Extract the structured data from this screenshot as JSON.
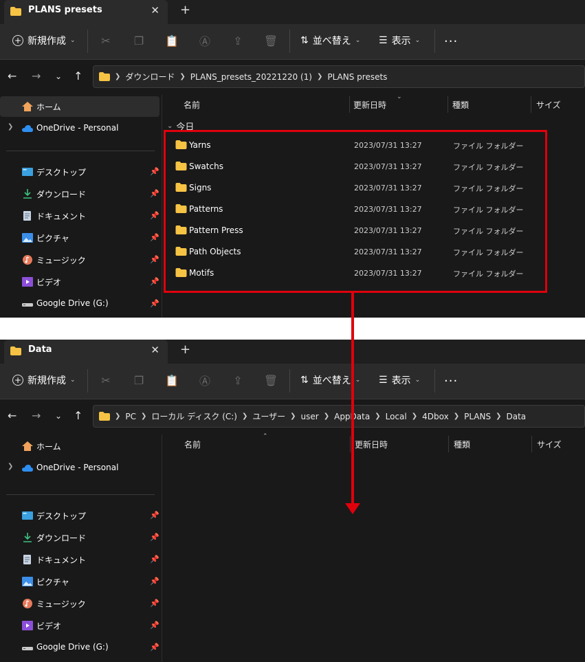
{
  "colors": {
    "window_bg": "#191919",
    "toolbar_bg": "#2b2b2b",
    "folder_yellow": "#f6c344",
    "annotation_red": "#e0000c"
  },
  "top": {
    "tab_title": "PLANS presets",
    "toolbar": {
      "new_label": "新規作成",
      "sort_label": "並べ替え",
      "view_label": "表示",
      "more_label": "..."
    },
    "breadcrumb": [
      "ダウンロード",
      "PLANS_presets_20221220 (1)",
      "PLANS presets"
    ],
    "columns": {
      "name": "名前",
      "date": "更新日時",
      "type": "種類",
      "size": "サイズ"
    },
    "group_label": "今日",
    "files": [
      {
        "name": "Yarns",
        "date": "2023/07/31 13:27",
        "type": "ファイル フォルダー"
      },
      {
        "name": "Swatchs",
        "date": "2023/07/31 13:27",
        "type": "ファイル フォルダー"
      },
      {
        "name": "Signs",
        "date": "2023/07/31 13:27",
        "type": "ファイル フォルダー"
      },
      {
        "name": "Patterns",
        "date": "2023/07/31 13:27",
        "type": "ファイル フォルダー"
      },
      {
        "name": "Pattern Press",
        "date": "2023/07/31 13:27",
        "type": "ファイル フォルダー"
      },
      {
        "name": "Path Objects",
        "date": "2023/07/31 13:27",
        "type": "ファイル フォルダー"
      },
      {
        "name": "Motifs",
        "date": "2023/07/31 13:27",
        "type": "ファイル フォルダー"
      }
    ]
  },
  "bottom": {
    "tab_title": "Data",
    "toolbar": {
      "new_label": "新規作成",
      "sort_label": "並べ替え",
      "view_label": "表示",
      "more_label": "..."
    },
    "breadcrumb": [
      "PC",
      "ローカル ディスク (C:)",
      "ユーザー",
      "user",
      "AppData",
      "Local",
      "4Dbox",
      "PLANS",
      "Data"
    ],
    "columns": {
      "name": "名前",
      "date": "更新日時",
      "type": "種類",
      "size": "サイズ"
    }
  },
  "sidebar": {
    "home": "ホーム",
    "onedrive": "OneDrive - Personal",
    "items": [
      {
        "label": "デスクトップ",
        "icon": "desktop-icon"
      },
      {
        "label": "ダウンロード",
        "icon": "download-icon"
      },
      {
        "label": "ドキュメント",
        "icon": "document-icon"
      },
      {
        "label": "ピクチャ",
        "icon": "pictures-icon"
      },
      {
        "label": "ミュージック",
        "icon": "music-icon"
      },
      {
        "label": "ビデオ",
        "icon": "video-icon"
      },
      {
        "label": "Google Drive (G:)",
        "icon": "drive-icon"
      }
    ]
  }
}
